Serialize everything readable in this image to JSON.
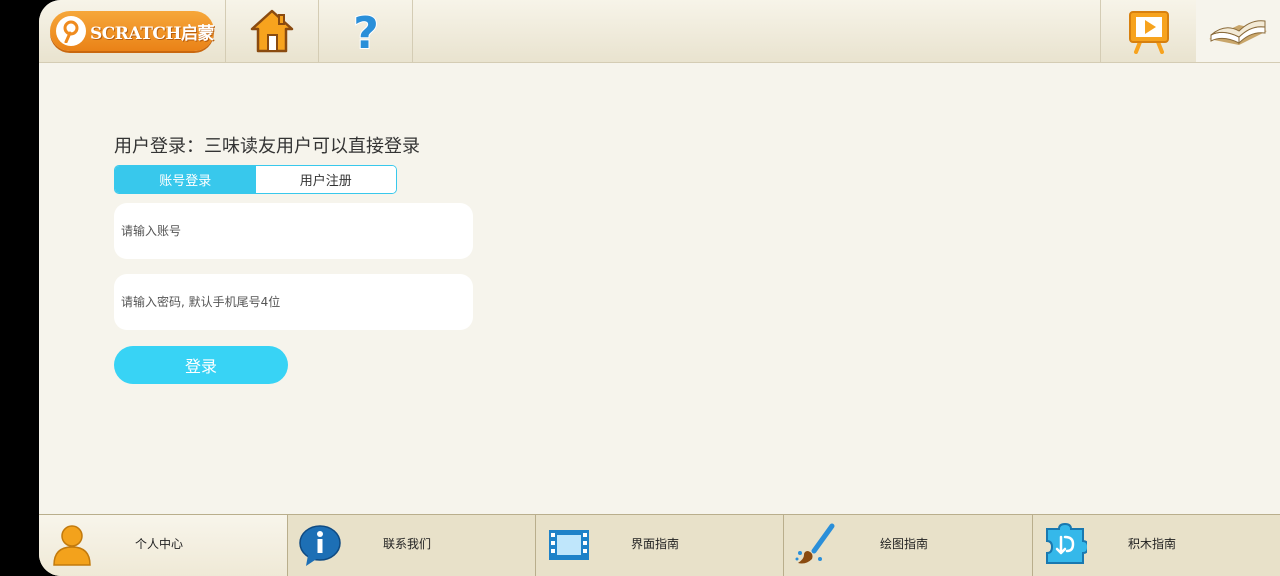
{
  "topbar": {
    "logo_text": "SCRATCH启蒙",
    "icons": [
      "scratch-logo",
      "home-icon",
      "help-icon",
      "video-icon",
      "book-icon"
    ]
  },
  "login": {
    "title": "用户登录：三味读友用户可以直接登录",
    "tabs": [
      {
        "label": "账号登录",
        "active": true
      },
      {
        "label": "用户注册",
        "active": false
      }
    ],
    "account_placeholder": "请输入账号",
    "password_placeholder": "请输入密码, 默认手机尾号4位",
    "submit_label": "登录"
  },
  "bottom_nav": {
    "items": [
      {
        "label": "个人中心",
        "icon": "person-icon",
        "active": true
      },
      {
        "label": "联系我们",
        "icon": "info-icon",
        "active": false
      },
      {
        "label": "界面指南",
        "icon": "film-icon",
        "active": false
      },
      {
        "label": "绘图指南",
        "icon": "paintbrush-icon",
        "active": false
      },
      {
        "label": "积木指南",
        "icon": "puzzle-block-icon",
        "active": false
      }
    ]
  },
  "colors": {
    "accent": "#38c8ec",
    "button": "#38d3f5",
    "background": "#f6f4ec",
    "logo_orange": "#ef8b1f"
  }
}
